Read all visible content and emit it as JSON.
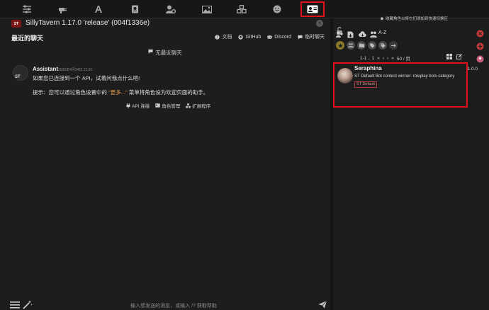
{
  "topbar": {
    "icons": [
      "sliders-icon",
      "plug-icon",
      "font-icon",
      "book-icon",
      "user-gear-icon",
      "image-icon",
      "cubes-icon",
      "smile-icon",
      "id-card-icon"
    ]
  },
  "chat": {
    "app_title": "SillyTavern 1.17.0 'release' (004f1336e)",
    "logo_text": "ST",
    "recent_title": "最近的聊天",
    "links": {
      "docs": "文档",
      "github": "GitHub",
      "discord": "Discord",
      "temp_chat": "临时聊天"
    },
    "no_recent": "无最近聊天",
    "message": {
      "sender": "Assistant",
      "timestamp": "2026年4月24日 21:01",
      "avatar_text": "ST",
      "line1": "如果您已连接到一个 API，试着问我点什么吧!",
      "line2_prefix": "提示：您可以通过角色设置中的",
      "line2_highlight": "\"更多...\"",
      "line2_suffix": "菜单将角色设为欢迎页面的助手。",
      "actions": {
        "api": "API 连接",
        "chars": "角色管理",
        "ext": "扩展程序"
      }
    },
    "input_placeholder": "输入想发送的消息，或输入 /? 获取帮助"
  },
  "rpanel": {
    "fav_hint": "收藏角色以将它们添加到快速切换区",
    "sort_value": "A-Z",
    "pager": {
      "range": "1-1 .. 1",
      "page_size": "50 / 页"
    },
    "card": {
      "name": "Seraphina",
      "version": "1.0.0",
      "desc": "ST Default Bot contest winner: roleplay bots category",
      "tag": "ST Default"
    }
  },
  "colors": {
    "highlight_border": "#e0121a",
    "accent_orange": "#e89a44",
    "side_red": "#c83a3a"
  }
}
